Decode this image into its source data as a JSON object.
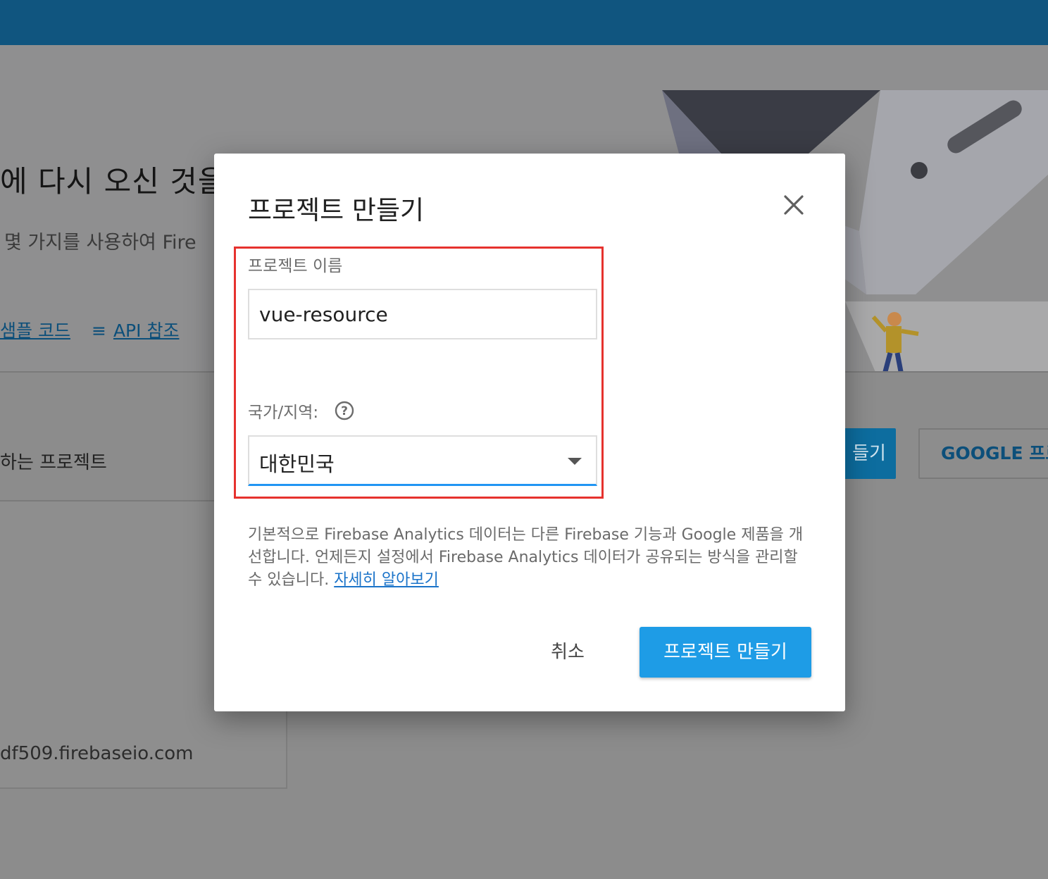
{
  "background": {
    "hero": {
      "title": "에 다시 오신 것을 환영합니다.",
      "subtitle": "몇 가지를 사용하여 Fire",
      "links": [
        {
          "label": "샘플 코드"
        },
        {
          "label": "API 참조",
          "icon": "list-icon"
        }
      ]
    },
    "projects_section": {
      "title": "하는 프로젝트",
      "primary_button_label": "들기",
      "secondary_button_label": "GOOGLE 프로",
      "card_url": "df509.firebaseio.com"
    }
  },
  "dialog": {
    "title": "프로젝트 만들기",
    "close_icon": "close-icon",
    "project_name": {
      "label": "프로젝트 이름",
      "value": "vue-resource"
    },
    "region": {
      "label": "국가/지역:",
      "help_icon": "help-icon",
      "selected": "대한민국"
    },
    "notice": {
      "text": "기본적으로 Firebase Analytics 데이터는 다른 Firebase 기능과 Google 제품을 개선합니다. 언제든지 설정에서 Firebase Analytics 데이터가 공유되는 방식을 관리할 수 있습니다.",
      "link_label": "자세히 알아보기"
    },
    "cancel_label": "취소",
    "create_label": "프로젝트 만들기"
  },
  "colors": {
    "topbar": "#10557f",
    "primary": "#1e9ce6",
    "highlight": "#e6322e",
    "link": "#1a73c9"
  }
}
